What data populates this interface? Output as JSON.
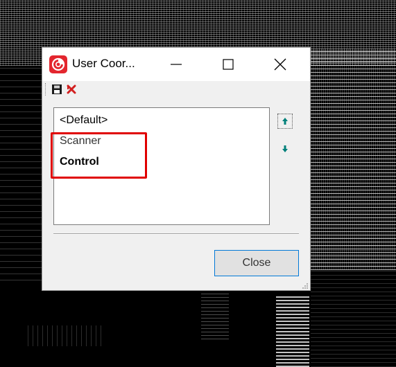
{
  "window": {
    "title": "User Coor...",
    "controls": [
      "minimize",
      "maximize",
      "close"
    ]
  },
  "toolbar": {
    "icons": [
      "save-icon",
      "delete-icon"
    ]
  },
  "list": {
    "items": [
      {
        "label": "<Default>"
      },
      {
        "label": "Scanner"
      },
      {
        "label": "Control"
      }
    ],
    "highlighted_items": [
      "Scanner",
      "Control"
    ]
  },
  "side_buttons": [
    "move-up-icon",
    "move-down-icon"
  ],
  "footer": {
    "close_label": "Close"
  },
  "colors": {
    "highlight": "#e00000",
    "arrow": "#00807a",
    "app_icon": "#e3262e",
    "focus_border": "#0078d7"
  }
}
